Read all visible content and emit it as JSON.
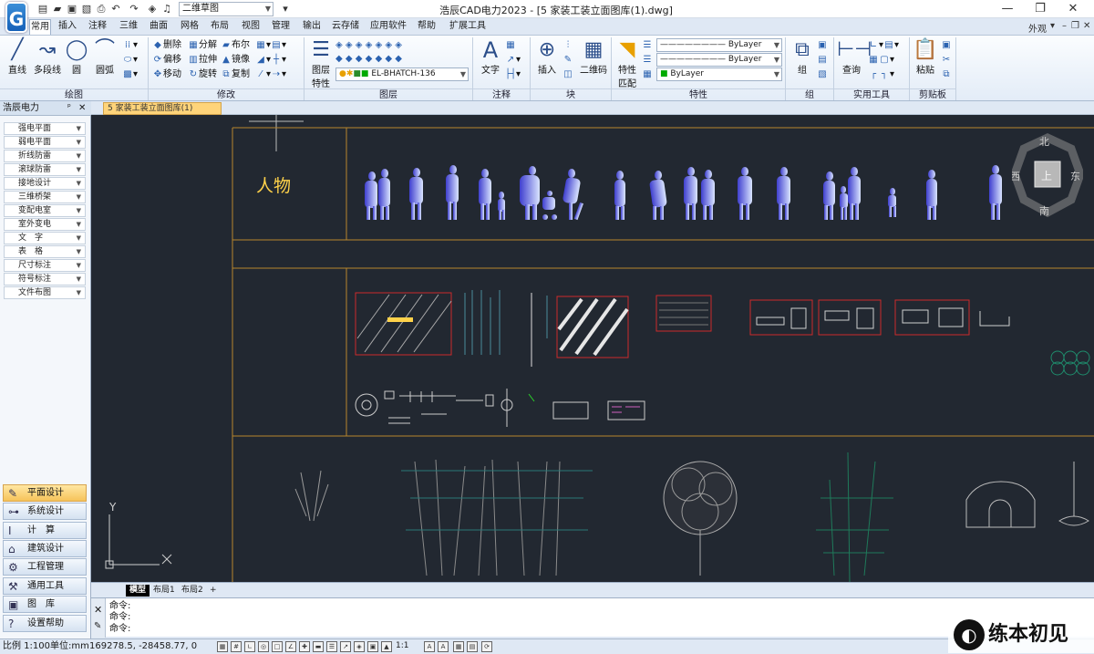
{
  "window": {
    "title": "浩辰CAD电力2023 - [5 家装工装立面图库(1).dwg]",
    "workspace": "二维草图",
    "appearance": "外观",
    "app_logo_letter": "G"
  },
  "tabs": [
    "常用",
    "插入",
    "注释",
    "三维",
    "曲面",
    "网格",
    "布局",
    "视图",
    "管理",
    "输出",
    "云存储",
    "应用软件",
    "帮助",
    "扩展工具"
  ],
  "ribbon": {
    "draw": {
      "label": "绘图",
      "line": "直线",
      "polyline": "多段线",
      "circle": "圆",
      "arc": "圆弧"
    },
    "modify": {
      "label": "修改",
      "erase": "删除",
      "explode": "分解",
      "boolean": "布尔",
      "offset": "偏移",
      "stretch": "拉伸",
      "mirror": "镜像",
      "move": "移动",
      "rotate": "旋转",
      "copy": "复制"
    },
    "layer": {
      "label": "图层",
      "props_line1": "图层",
      "props_line2": "特性",
      "current_layer": "EL-BHATCH-136"
    },
    "annotation": {
      "label": "注释",
      "text": "文字"
    },
    "block": {
      "label": "块",
      "insert": "插入",
      "qrcode": "二维码"
    },
    "properties": {
      "label": "特性",
      "match_line1": "特性",
      "match_line2": "匹配",
      "linetype": "ByLayer",
      "lineweight": "ByLayer",
      "color": "ByLayer"
    },
    "group": {
      "label": "组",
      "group": "组"
    },
    "utilities": {
      "label": "实用工具",
      "query": "查询"
    },
    "clipboard": {
      "label": "剪贴板",
      "paste": "粘贴"
    }
  },
  "doc_tab": "5  家装工装立面图库(1)",
  "left_panel": {
    "title": "浩辰电力",
    "items": [
      "强电平面",
      "弱电平面",
      "折线防雷",
      "滚球防雷",
      "接地设计",
      "三维桥架",
      "变配电室",
      "室外变电",
      "文　字",
      "表　格",
      "尺寸标注",
      "符号标注",
      "文件布图"
    ],
    "modules": [
      "平面设计",
      "系统设计",
      "计　算",
      "建筑设计",
      "工程管理",
      "通用工具",
      "图　库",
      "设置帮助"
    ]
  },
  "drawing": {
    "section_label": "人物",
    "ucs_x": "X",
    "ucs_y": "Y",
    "viewcube": {
      "north": "北",
      "south": "南",
      "east": "东",
      "west": "西",
      "top": "上"
    }
  },
  "layout_tabs": [
    "模型",
    "布局1",
    "布局2"
  ],
  "command_lines": [
    "命令:",
    "命令:",
    "命令:"
  ],
  "status": {
    "scale": "比例 1:100",
    "unit": "单位:mm",
    "coords": "169278.5, -28458.77, 0",
    "annotation_scale": "1:1"
  },
  "watermark": {
    "text": "练本初见"
  },
  "colors": {
    "canvas": "#222831",
    "figure_gradient_start": "#3f3fcf",
    "figure_gradient_end": "#d9e4ff",
    "section_line": "#b8862d",
    "label_text": "#ffd24a"
  }
}
